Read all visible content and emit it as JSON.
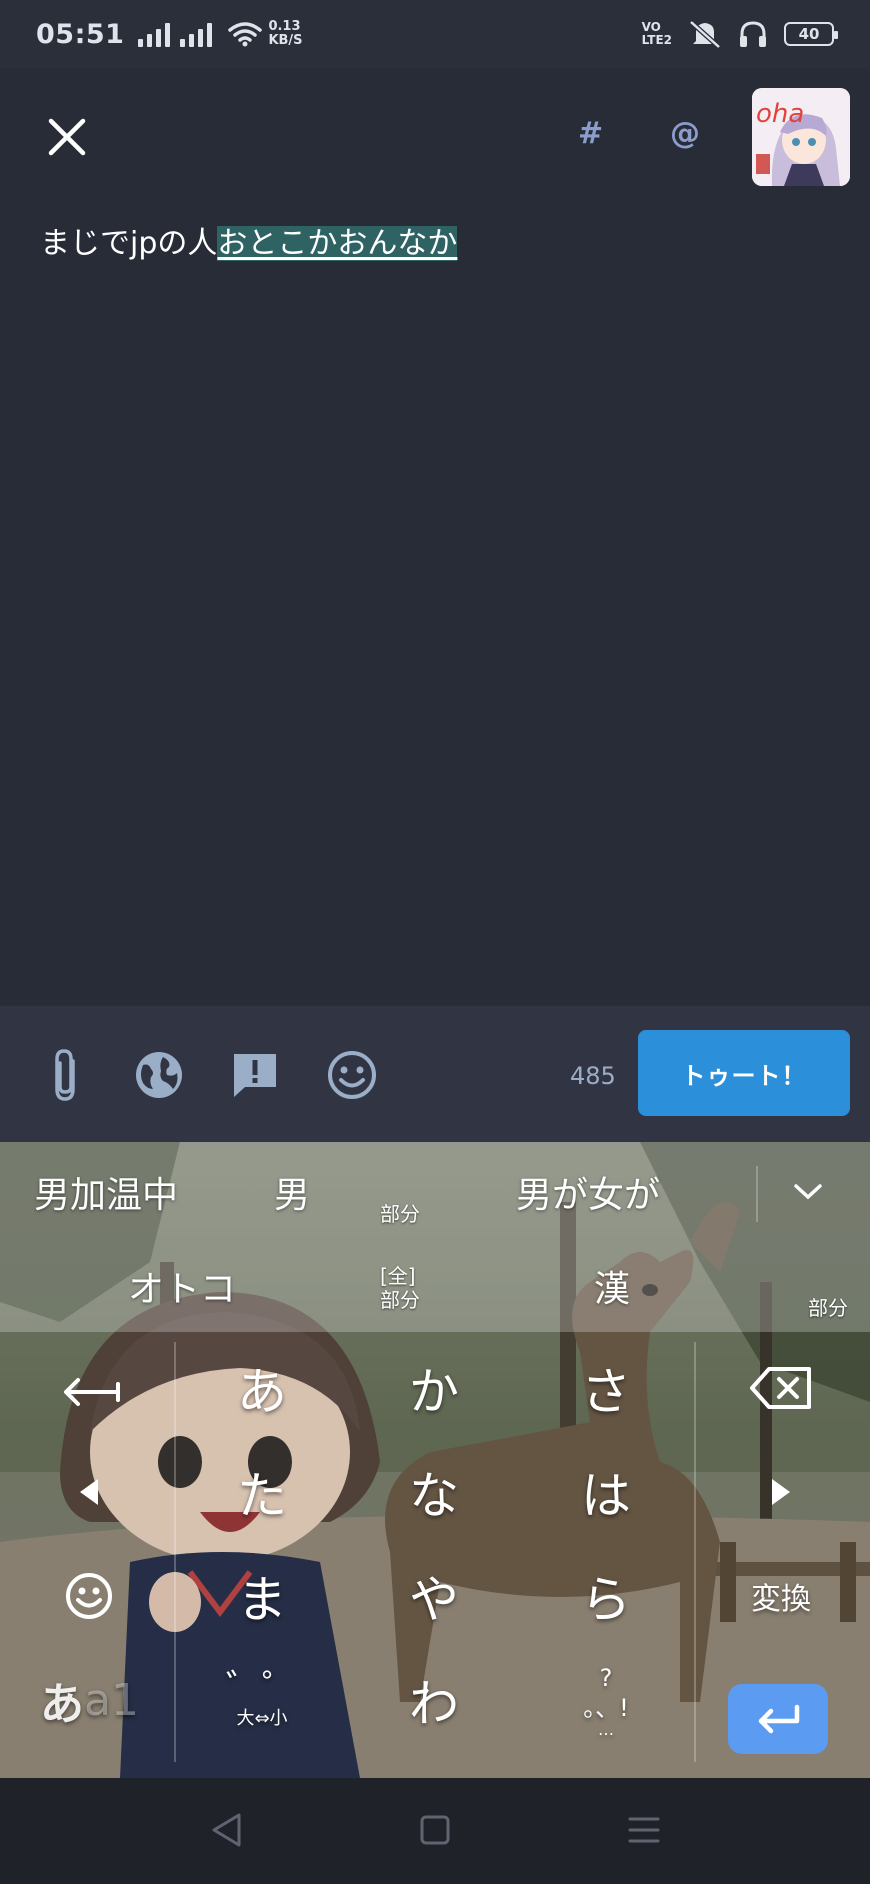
{
  "status_bar": {
    "time": "05:51",
    "net_speed_value": "0.13",
    "net_speed_unit": "KB/S",
    "volte_top": "VO",
    "volte_bottom": "LTE2",
    "battery": "40"
  },
  "compose": {
    "hashtag_label": "#",
    "mention_label": "@",
    "text_committed": "まじでjpの人",
    "text_composing": "おとこかおんなか",
    "char_count": "485",
    "toot_label": "トゥート！"
  },
  "keyboard": {
    "candidates_row1": [
      "男加温中",
      "男",
      "男が女が"
    ],
    "candidates_row2": [
      "オトコ",
      "漢"
    ],
    "small_labels": {
      "partial_1": "部分",
      "full_top": "[全]",
      "full_bottom": "部分",
      "partial_2": "部分"
    },
    "keys": {
      "a": "あ",
      "ka": "か",
      "sa": "さ",
      "ta": "た",
      "na": "な",
      "ha": "は",
      "ma": "ま",
      "ya": "や",
      "ra": "ら",
      "dakuten": "゛゜",
      "dakuten_sub": "大⇔小",
      "wa": "わ",
      "punct_top": "?",
      "punct_main": "。、!",
      "punct_bottom": "…"
    },
    "convert_label": "変換",
    "mode_label_kana": "あ",
    "mode_label_alpha": "a1"
  },
  "colors": {
    "background": "#282c37",
    "toolbar": "#313543",
    "toot_button": "#2b90d9",
    "accent_icon": "#8c9dcc",
    "composing_highlight": "#2f6262",
    "enter_key": "#5b9cf2"
  }
}
